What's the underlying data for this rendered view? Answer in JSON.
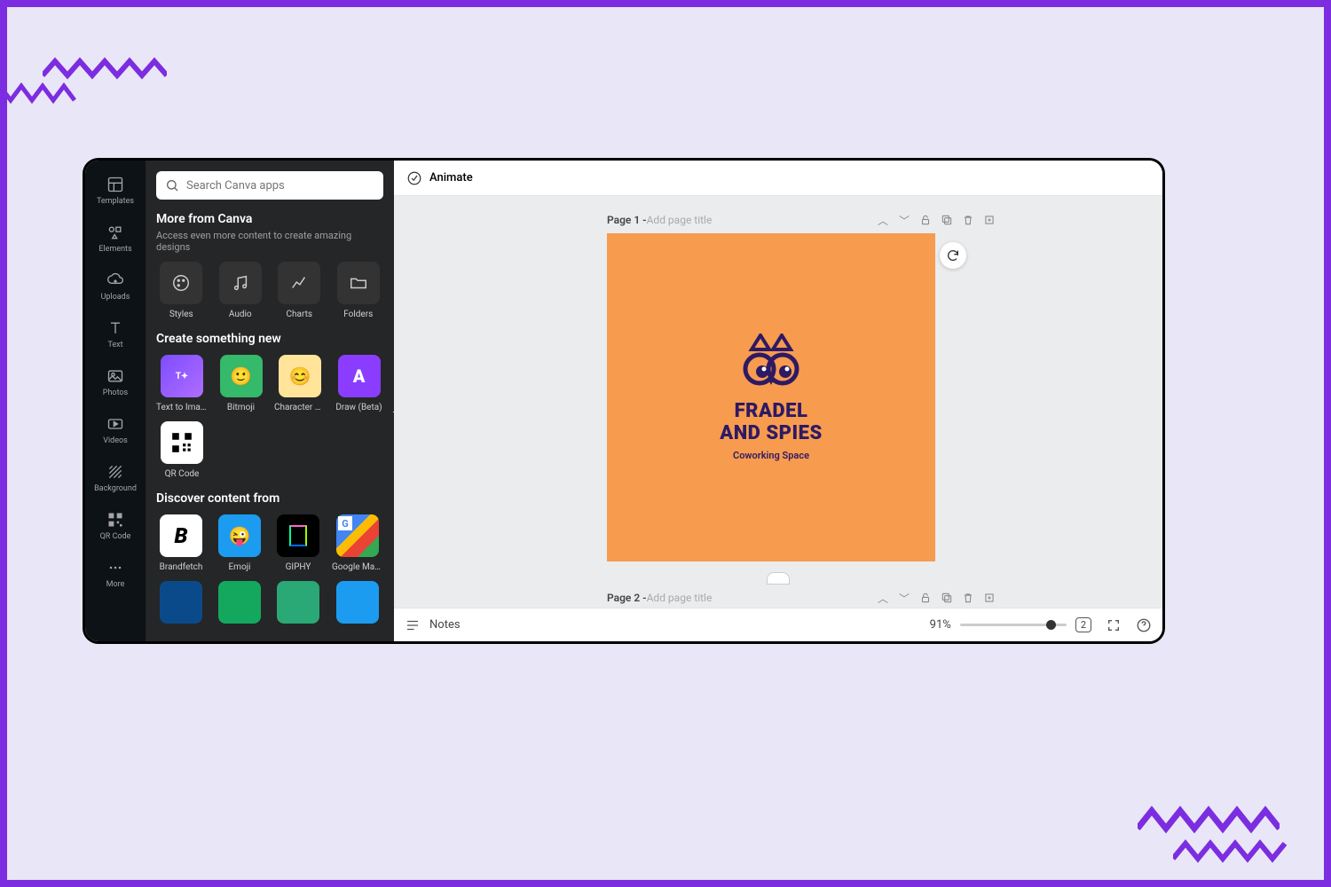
{
  "rail": [
    "Templates",
    "Elements",
    "Uploads",
    "Text",
    "Photos",
    "Videos",
    "Background",
    "QR Code",
    "More"
  ],
  "search": {
    "placeholder": "Search Canva apps"
  },
  "more": {
    "title": "More from Canva",
    "sub": "Access even more content to create amazing designs",
    "tiles": [
      "Styles",
      "Audio",
      "Charts",
      "Folders"
    ]
  },
  "create": {
    "title": "Create something new",
    "tiles": [
      "Text to Imag...",
      "Bitmoji",
      "Character B...",
      "Draw (Beta)",
      "QR Code"
    ]
  },
  "discover": {
    "title": "Discover content from",
    "tiles": [
      "Brandfetch",
      "Emoji",
      "GIPHY",
      "Google Maps"
    ]
  },
  "toolbar": {
    "animate": "Animate"
  },
  "page1": {
    "label": "Page 1 - ",
    "placeholder": "Add page title"
  },
  "page2": {
    "label": "Page 2 - ",
    "placeholder": "Add page title"
  },
  "design": {
    "line1": "FRADEL",
    "line2": "AND SPIES",
    "tag": "Coworking Space"
  },
  "footer": {
    "notes": "Notes",
    "zoom": "91%",
    "pages": "2"
  }
}
